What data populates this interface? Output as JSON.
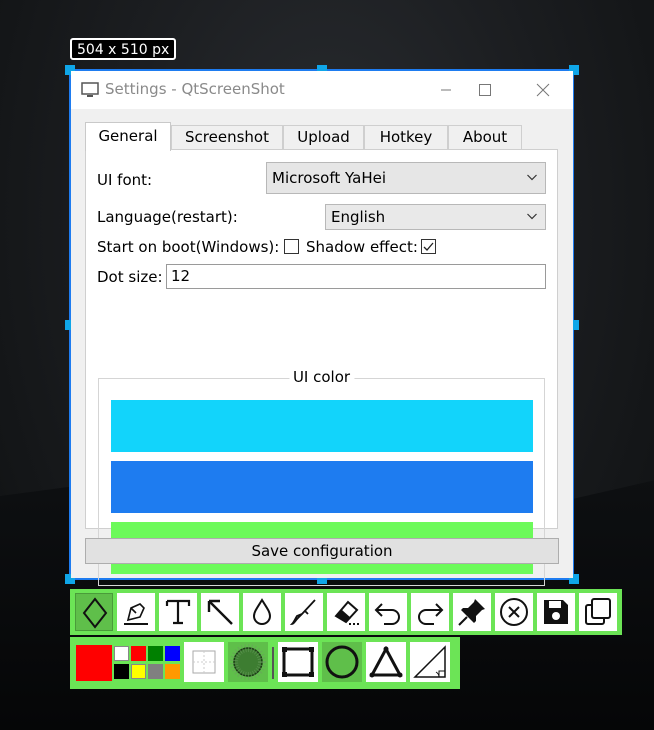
{
  "selection_size": "504 x 510 px",
  "window": {
    "title": "Settings - QtScreenShot"
  },
  "tabs": [
    {
      "label": "General"
    },
    {
      "label": "Screenshot"
    },
    {
      "label": "Upload"
    },
    {
      "label": "Hotkey"
    },
    {
      "label": "About"
    }
  ],
  "general": {
    "ui_font_label": "UI font:",
    "ui_font_value": "Microsoft YaHei",
    "language_label": "Language(restart):",
    "language_value": "English",
    "start_on_boot_label": "Start on boot(Windows):",
    "start_on_boot_checked": false,
    "shadow_effect_label": "Shadow effect:",
    "shadow_effect_checked": true,
    "dot_size_label": "Dot size:",
    "dot_size_value": "12",
    "ui_color_title": "UI color",
    "ui_colors": [
      "#12d4fb",
      "#1e7cf0",
      "#6cfa5a"
    ],
    "save_label": "Save configuration"
  },
  "toolbar_main": [
    {
      "icon": "diamond-icon",
      "selected": true
    },
    {
      "icon": "pen-icon",
      "selected": false
    },
    {
      "icon": "text-icon",
      "selected": false
    },
    {
      "icon": "arrow-icon",
      "selected": false
    },
    {
      "icon": "blur-drop-icon",
      "selected": false
    },
    {
      "icon": "brush-icon",
      "selected": false
    },
    {
      "icon": "eraser-icon",
      "selected": false
    },
    {
      "icon": "undo-icon",
      "selected": false
    },
    {
      "icon": "redo-icon",
      "selected": false
    },
    {
      "icon": "pin-icon",
      "selected": false
    },
    {
      "icon": "close-circle-icon",
      "selected": false
    },
    {
      "icon": "save-icon",
      "selected": false
    },
    {
      "icon": "copy-icon",
      "selected": false
    }
  ],
  "toolbar_secondary": {
    "current_color": "#ff0000",
    "palette": [
      "#ffffff",
      "#ff0000",
      "#008000",
      "#0000ff",
      "#000000",
      "#ffff00",
      "#808080",
      "#ff9900"
    ],
    "tools": [
      {
        "icon": "dotted-square-icon",
        "selected": false
      },
      {
        "icon": "filled-circle-icon",
        "selected": true
      },
      {
        "icon": "rectangle-icon",
        "selected": false
      },
      {
        "icon": "ellipse-icon",
        "selected": true
      },
      {
        "icon": "triangle-icon",
        "selected": false
      },
      {
        "icon": "right-triangle-icon",
        "selected": false
      }
    ]
  }
}
